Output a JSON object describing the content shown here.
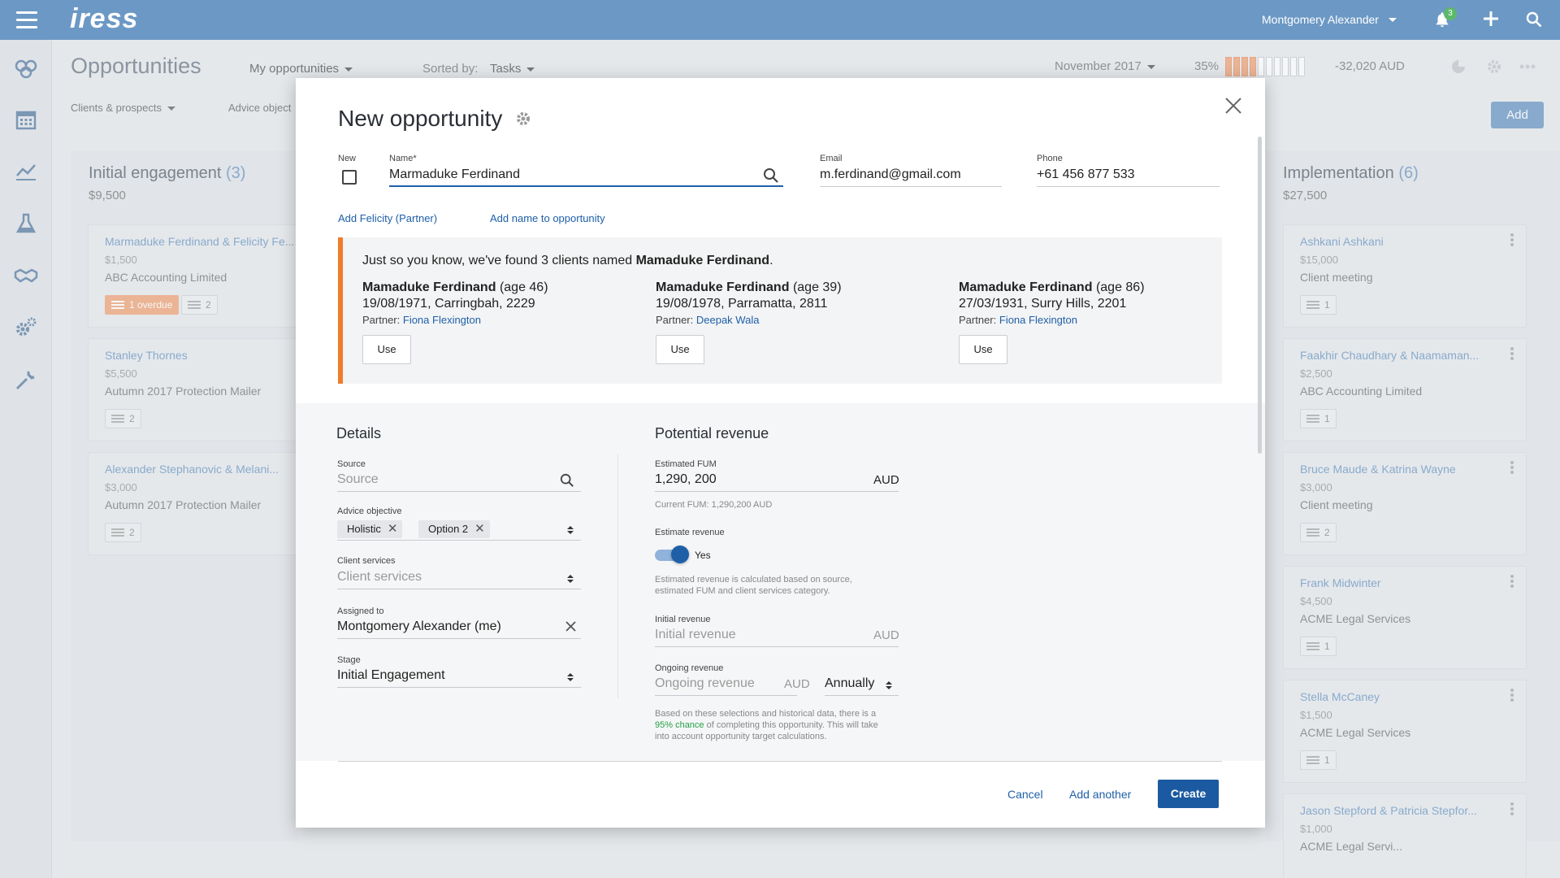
{
  "app": {
    "logo": "iress"
  },
  "topbar": {
    "user": "Montgomery Alexander",
    "notification_count": "3",
    "icons": [
      "menu-icon",
      "bell-icon",
      "plus-icon",
      "search-icon"
    ]
  },
  "leftnav": {
    "icons": [
      "clients-icon",
      "calendar-icon",
      "chart-icon",
      "flask-icon",
      "handshake-icon",
      "settings-icon",
      "wrench-icon",
      "expand-icon"
    ]
  },
  "header": {
    "title": "Opportunities",
    "view": "My opportunities",
    "sorted_by_label": "Sorted by:",
    "sorted_by_value": "Tasks",
    "period": "November 2017",
    "progress_pct": "35%",
    "progress_fraction": 0.35,
    "amount": "-32,020 AUD"
  },
  "subnav": {
    "filter1": "Clients & prospects",
    "filter2": "Advice object",
    "add_label": "Add"
  },
  "columns": {
    "left": {
      "title": "Initial engagement",
      "count": "(3)",
      "sum": "$9,500",
      "cards": [
        {
          "name": "Marmaduke Ferdinand & Felicity Fe...",
          "amount": "$1,500",
          "sub": "ABC Accounting Limited",
          "overdue": "1 overdue",
          "tasks": "2"
        },
        {
          "name": "Stanley Thornes",
          "amount": "$5,500",
          "sub": "Autumn 2017 Protection Mailer",
          "tasks": "2"
        },
        {
          "name": "Alexander Stephanovic & Melani...",
          "amount": "$3,000",
          "sub": "Autumn 2017 Protection Mailer",
          "tasks": "2"
        }
      ]
    },
    "right": {
      "title": "Implementation",
      "count": "(6)",
      "sum": "$27,500",
      "cards": [
        {
          "name": "Ashkani Ashkani",
          "amount": "$15,000",
          "sub": "Client meeting",
          "tasks": "1"
        },
        {
          "name": "Faakhir Chaudhary & Naamaman...",
          "amount": "$2,500",
          "sub": "ABC Accounting Limited",
          "tasks": "1"
        },
        {
          "name": "Bruce Maude & Katrina Wayne",
          "amount": "$3,000",
          "sub": "Client meeting",
          "tasks": "2"
        },
        {
          "name": "Frank Midwinter",
          "amount": "$4,500",
          "sub": "ACME Legal Services",
          "tasks": "1"
        },
        {
          "name": "Stella McCaney",
          "amount": "$1,500",
          "sub": "ACME Legal Services",
          "tasks": "1"
        },
        {
          "name": "Jason Stepford & Patricia Stepfor...",
          "amount": "$1,000",
          "sub": "ACME Legal Servi..."
        }
      ]
    }
  },
  "modal": {
    "title": "New opportunity",
    "new_label": "New",
    "name_label": "Name*",
    "name_value": "Marmaduke Ferdinand",
    "email_label": "Email",
    "email_value": "m.ferdinand@gmail.com",
    "phone_label": "Phone",
    "phone_value": "+61 456 877 533",
    "link_partner": "Add Felicity (Partner)",
    "link_name": "Add name to opportunity",
    "alert": {
      "prefix": "Just so you know, we've found 3 clients named ",
      "name": "Mamaduke Ferdinand",
      "suffix": ".",
      "matches": [
        {
          "name": "Mamaduke Ferdinand",
          "age": "(age 46)",
          "detail": "19/08/1971, Carringbah, 2229",
          "partner_label": "Partner:",
          "partner": "Fiona Flexington",
          "use": "Use"
        },
        {
          "name": "Mamaduke Ferdinand",
          "age": "(age 39)",
          "detail": "19/08/1978, Parramatta, 2811",
          "partner_label": "Partner:",
          "partner": "Deepak Wala",
          "use": "Use"
        },
        {
          "name": "Mamaduke Ferdinand",
          "age": "(age 86)",
          "detail": "27/03/1931, Surry Hills, 2201",
          "partner_label": "Partner:",
          "partner": "Fiona Flexington",
          "use": "Use"
        }
      ]
    },
    "details": {
      "title": "Details",
      "source_label": "Source",
      "source_placeholder": "Source",
      "advice_label": "Advice objective",
      "advice_tags": [
        "Holistic",
        "Option 2"
      ],
      "services_label": "Client services",
      "services_placeholder": "Client services",
      "assigned_label": "Assigned to",
      "assigned_value": "Montgomery Alexander (me)",
      "stage_label": "Stage",
      "stage_value": "Initial Engagement"
    },
    "revenue": {
      "title": "Potential revenue",
      "fum_label": "Estimated FUM",
      "fum_value": "1,290, 200",
      "fum_unit": "AUD",
      "current_fum": "Current FUM: 1,290,200 AUD",
      "estimate_label": "Estimate revenue",
      "estimate_toggle": "Yes",
      "estimate_help": "Estimated revenue is calculated based on source, estimated FUM and client services category.",
      "initial_label": "Initial revenue",
      "initial_placeholder": "Initial revenue",
      "initial_unit": "AUD",
      "ongoing_label": "Ongoing revenue",
      "ongoing_placeholder": "Ongoing revenue",
      "ongoing_unit": "AUD",
      "frequency": "Annually",
      "chance_prefix": "Based on these selections and historical data, there is a ",
      "chance_value": "95% chance",
      "chance_suffix": " of completing this opportunity. This will take into account opportunity target calculations."
    },
    "buttons": {
      "cancel": "Cancel",
      "add_another": "Add another",
      "create": "Create"
    }
  },
  "colors": {
    "topbar": "#6c98c5",
    "primary": "#1b5aa0",
    "alert_accent": "#f07c2a",
    "overdue": "#f0a67a",
    "chance": "#24a148"
  }
}
